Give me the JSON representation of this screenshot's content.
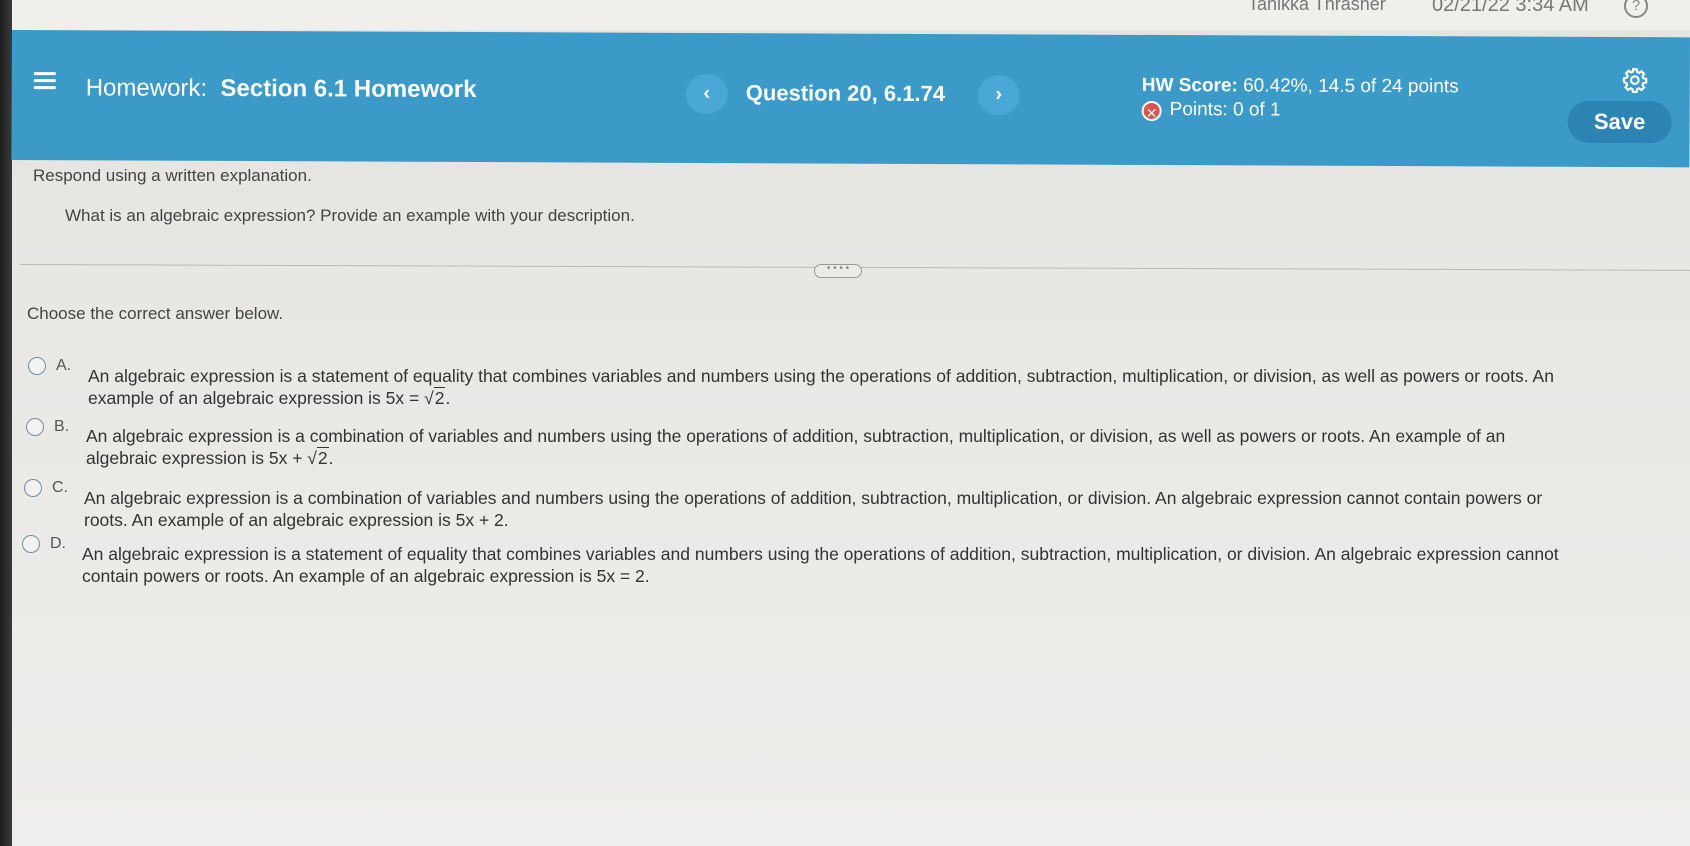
{
  "topbar": {
    "user": "Tanikka Thrasher",
    "datetime": "02/21/22 3:34 AM"
  },
  "header": {
    "title_prefix": "Homework:",
    "title": "Section 6.1 Homework",
    "question": "Question 20, 6.1.74",
    "hw_score_label": "HW Score:",
    "hw_score_value": "60.42%, 14.5 of 24 points",
    "points": "Points: 0 of 1",
    "save_label": "Save",
    "prev_symbol": "‹",
    "next_symbol": "›"
  },
  "question": {
    "instruction": "Respond using a written explanation.",
    "prompt": "What is an algebraic expression? Provide an example with your description.",
    "divider_handle": "• • • •",
    "choose_label": "Choose the correct answer below."
  },
  "options": [
    {
      "letter": "A.",
      "line1": "An algebraic expression is a statement of equality that combines variables and numbers using the operations of addition, subtraction, multiplication, or division, as well as powers or roots. An",
      "line2_prefix": "example of an algebraic expression is 5x = ",
      "radical": "2",
      "line2_suffix": "."
    },
    {
      "letter": "B.",
      "line1": "An algebraic expression is a combination of variables and numbers using the operations of addition, subtraction, multiplication, or division, as well as powers or roots. An example of an",
      "line2_prefix": "algebraic expression is 5x + ",
      "radical": "2",
      "line2_suffix": "."
    },
    {
      "letter": "C.",
      "line1": "An algebraic expression is a combination of variables and numbers using the operations of addition, subtraction, multiplication, or division. An algebraic expression cannot contain powers or",
      "line2_prefix": "roots. An example of an algebraic expression is 5x + 2."
    },
    {
      "letter": "D.",
      "line1": "An algebraic expression is a statement of equality that combines variables and numbers using the operations of addition, subtraction, multiplication, or division. An algebraic expression cannot",
      "line2_prefix": "contain powers or roots. An example of an algebraic expression is 5x = 2."
    }
  ]
}
